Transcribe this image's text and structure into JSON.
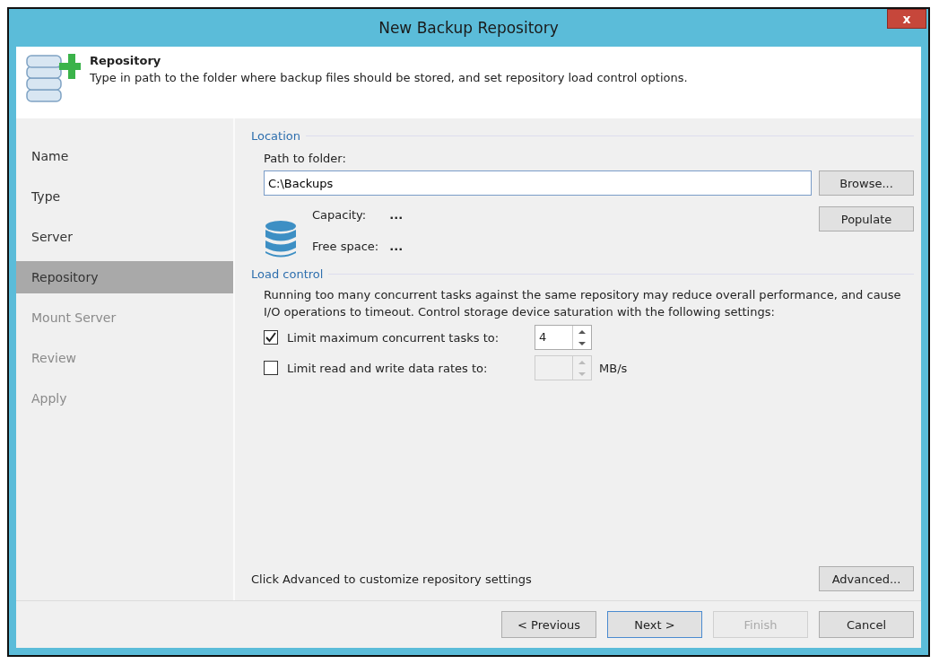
{
  "window": {
    "title": "New Backup Repository",
    "close": "x"
  },
  "header": {
    "title": "Repository",
    "description": "Type in path to the folder where backup files should be stored, and set repository load control options."
  },
  "sidebar": {
    "items": [
      {
        "label": "Name",
        "selected": false,
        "disabled": false
      },
      {
        "label": "Type",
        "selected": false,
        "disabled": false
      },
      {
        "label": "Server",
        "selected": false,
        "disabled": false
      },
      {
        "label": "Repository",
        "selected": true,
        "disabled": false
      },
      {
        "label": "Mount Server",
        "selected": false,
        "disabled": true
      },
      {
        "label": "Review",
        "selected": false,
        "disabled": true
      },
      {
        "label": "Apply",
        "selected": false,
        "disabled": true
      }
    ]
  },
  "location": {
    "heading": "Location",
    "path_label": "Path to folder:",
    "path_value": "C:\\Backups",
    "browse": "Browse...",
    "populate": "Populate",
    "capacity_label": "Capacity:",
    "capacity_value": "...",
    "free_label": "Free space:",
    "free_value": "..."
  },
  "load_control": {
    "heading": "Load control",
    "description": "Running too many concurrent tasks against the same repository may reduce overall performance, and cause I/O operations to timeout. Control storage device saturation with the following settings:",
    "options": [
      {
        "label": "Limit maximum concurrent tasks to:",
        "checked": true,
        "value": "4"
      },
      {
        "label": "Limit read and write data rates to:",
        "checked": false,
        "unit": "MB/s"
      }
    ]
  },
  "advanced": {
    "hint": "Click Advanced to customize repository settings",
    "button": "Advanced..."
  },
  "buttons": [
    {
      "label": "< Previous",
      "disabled": false,
      "default": false
    },
    {
      "label": "Next >",
      "disabled": false,
      "default": true
    },
    {
      "label": "Finish",
      "disabled": true,
      "default": false
    },
    {
      "label": "Cancel",
      "disabled": false,
      "default": false
    }
  ]
}
